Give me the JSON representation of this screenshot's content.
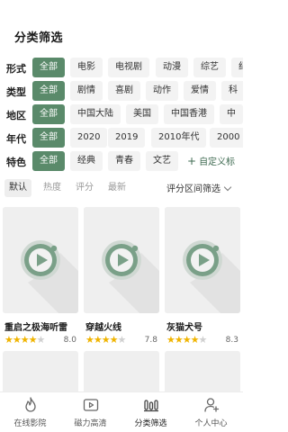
{
  "page_title": "分类筛选",
  "filters": [
    {
      "label": "形式",
      "options": [
        "全部",
        "电影",
        "电视剧",
        "动漫",
        "综艺",
        "纪"
      ],
      "selected": 0
    },
    {
      "label": "类型",
      "options": [
        "全部",
        "剧情",
        "喜剧",
        "动作",
        "爱情",
        "科"
      ],
      "selected": 0
    },
    {
      "label": "地区",
      "options": [
        "全部",
        "中国大陆",
        "美国",
        "中国香港",
        "中"
      ],
      "selected": 0
    },
    {
      "label": "年代",
      "options": [
        "全部",
        "2020",
        "2019",
        "2010年代",
        "2000"
      ],
      "selected": 0
    },
    {
      "label": "特色",
      "options": [
        "全部",
        "经典",
        "青春",
        "文艺"
      ],
      "selected": 0,
      "custom_tag": "自定义标"
    }
  ],
  "sort": {
    "options": [
      "默认",
      "热度",
      "评分",
      "最新"
    ],
    "selected": 0,
    "range_label": "评分区间筛选"
  },
  "movies": [
    {
      "title": "重启之极海听雷",
      "rating": 8.0,
      "score": "8.0",
      "stars_filled": 4
    },
    {
      "title": "穿越火线",
      "rating": 7.8,
      "score": "7.8",
      "stars_filled": 4
    },
    {
      "title": "灰猫犬号",
      "rating": 8.3,
      "score": "8.3",
      "stars_filled": 4
    }
  ],
  "tabs": [
    {
      "label": "在线影院",
      "icon": "flame-icon"
    },
    {
      "label": "磁力高清",
      "icon": "play-box-icon"
    },
    {
      "label": "分类筛选",
      "icon": "bars-icon"
    },
    {
      "label": "个人中心",
      "icon": "user-add-icon"
    }
  ],
  "selected_tab": 2,
  "colors": {
    "accent": "#5a8a6a",
    "star": "#f0b400",
    "play_circle": "#7aa088",
    "play_ring": "#cfd8d2"
  }
}
